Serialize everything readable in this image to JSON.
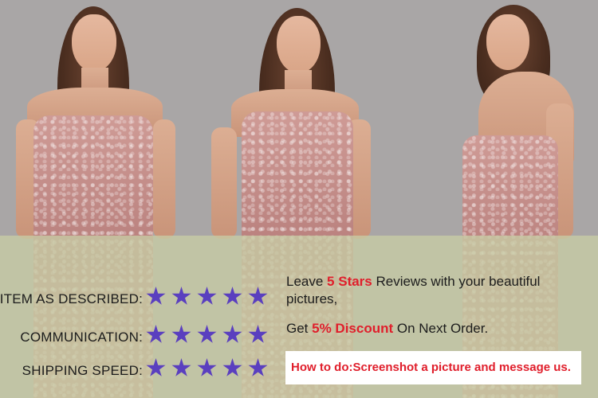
{
  "image": {
    "description_icons": [
      "model-photo-front",
      "model-photo-three-quarter",
      "model-photo-back"
    ],
    "colors": {
      "background": "#a9a6a6",
      "overlay": "#c8cda5",
      "star": "#5a3fbf",
      "accent": "#e01e2b",
      "dress": "#c48c86"
    }
  },
  "ratings": [
    {
      "label": "ITEM AS DESCRIBED:",
      "stars": 5
    },
    {
      "label": "COMMUNICATION:",
      "stars": 5
    },
    {
      "label": "SHIPPING SPEED:",
      "stars": 5
    }
  ],
  "promo": {
    "line1_prefix": "Leave ",
    "line1_accent": "5 Stars",
    "line1_suffix": " Reviews with your beautiful",
    "line1_cont": "pictures,",
    "line2_prefix": "Get ",
    "line2_accent": "5% Discount",
    "line2_suffix": " On Next Order.",
    "howto": "How to do:Screenshot a picture and message us."
  }
}
